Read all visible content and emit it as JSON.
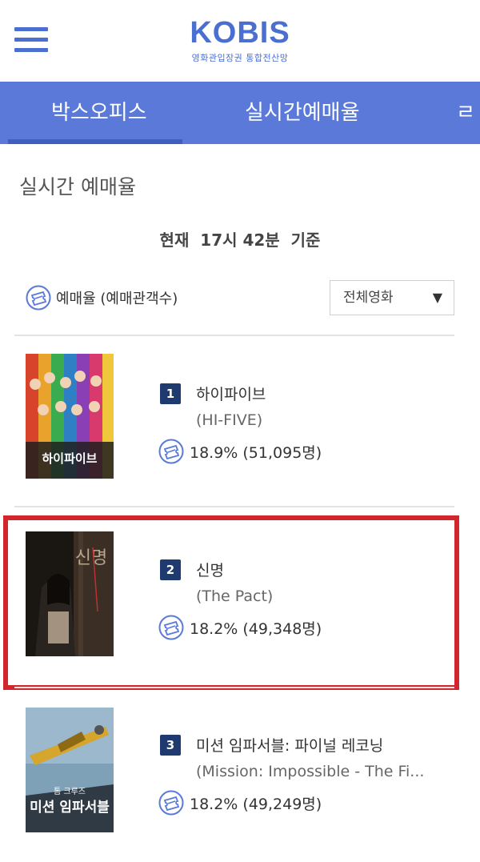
{
  "header": {
    "logo": "KOBIS",
    "logo_subtitle": "영화관입장권 통합전산망",
    "menu_icon": "hamburger-menu-icon"
  },
  "tabs": [
    {
      "label": "박스오피스",
      "active": true
    },
    {
      "label": "실시간예매율",
      "active": false
    },
    {
      "label": "ㄹ",
      "active": false
    }
  ],
  "section": {
    "title": "실시간 예매율",
    "timestamp": "현재  17시 42분  기준",
    "legend": "예매율 (예매관객수)",
    "filter_selected": "전체영화"
  },
  "movies": [
    {
      "rank": "1",
      "title": "하이파이브",
      "subtitle": "(HI-FIVE)",
      "rate": "18.9% (51,095명)",
      "poster_text": "하이파이브"
    },
    {
      "rank": "2",
      "title": "신명",
      "subtitle": "(The Pact)",
      "rate": "18.2% (49,348명)",
      "poster_text": "신명"
    },
    {
      "rank": "3",
      "title": "미션 임파서블: 파이널 레코닝",
      "subtitle": "(Mission: Impossible - The Fi...",
      "rate": "18.2% (49,249명)",
      "poster_text": "미션 임파서블",
      "poster_subtext": "톰 크루즈"
    }
  ],
  "colors": {
    "brand": "#4a6fd0",
    "tab_bar": "#5b79d9",
    "rank_badge": "#1f3a6e",
    "highlight_border": "#d0262c"
  }
}
